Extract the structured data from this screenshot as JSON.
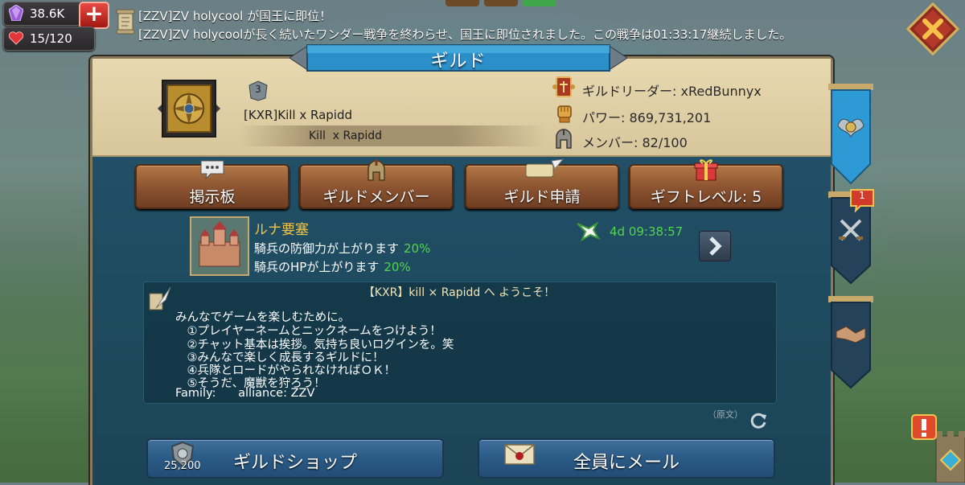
{
  "resources": {
    "gems": "38.6K",
    "stamina": "15/120"
  },
  "announcement": {
    "line1": "[ZZV]ZV holycool が国王に即位！",
    "line2": "[ZZV]ZV holycoolが長く続いたワンダー戦争を終わらせ、国王に即位されました。この戦争は01:33:17継続しました。"
  },
  "panel": {
    "title": "ギルド"
  },
  "guild": {
    "level": "3",
    "name": "[KXR]Kill x Rapidd",
    "motto": "Kill  x Rapidd",
    "leader": "ギルドリーダー: xRedBunnyx",
    "power": "パワー: 869,731,201",
    "members": "メンバー: 82/100"
  },
  "actions": {
    "board": "掲示板",
    "members": "ギルドメンバー",
    "apply": "ギルド申請",
    "gift": "ギフトレベル: 5"
  },
  "fortress": {
    "name": "ルナ要塞",
    "bonus1_text": "騎兵の防御力が上がります",
    "bonus1_pct": "20%",
    "bonus2_text": "騎兵のHPが上がります",
    "bonus2_pct": "20%",
    "timer": "4d 09:38:57"
  },
  "notice": {
    "title": "【KXR】kill × Rapidd へ ようこそ！",
    "lines": [
      "みんなでゲームを楽しむために。",
      "　①プレイヤーネームとニックネームをつけよう！",
      "　②チャット基本は挨拶。気持ち良いログインを。笑",
      "　③みんなで楽しく成長するギルドに！",
      "　④兵隊とロードがやられなければＯＫ！",
      "　⑤そうだ、魔獣を狩ろう！",
      "Family:      alliance: ZZV"
    ],
    "original_label": "（原文）"
  },
  "bottom": {
    "shop": "ギルドショップ",
    "shop_coins": "25,200",
    "mail": "全員にメール"
  },
  "side": {
    "notification_count": "1"
  }
}
